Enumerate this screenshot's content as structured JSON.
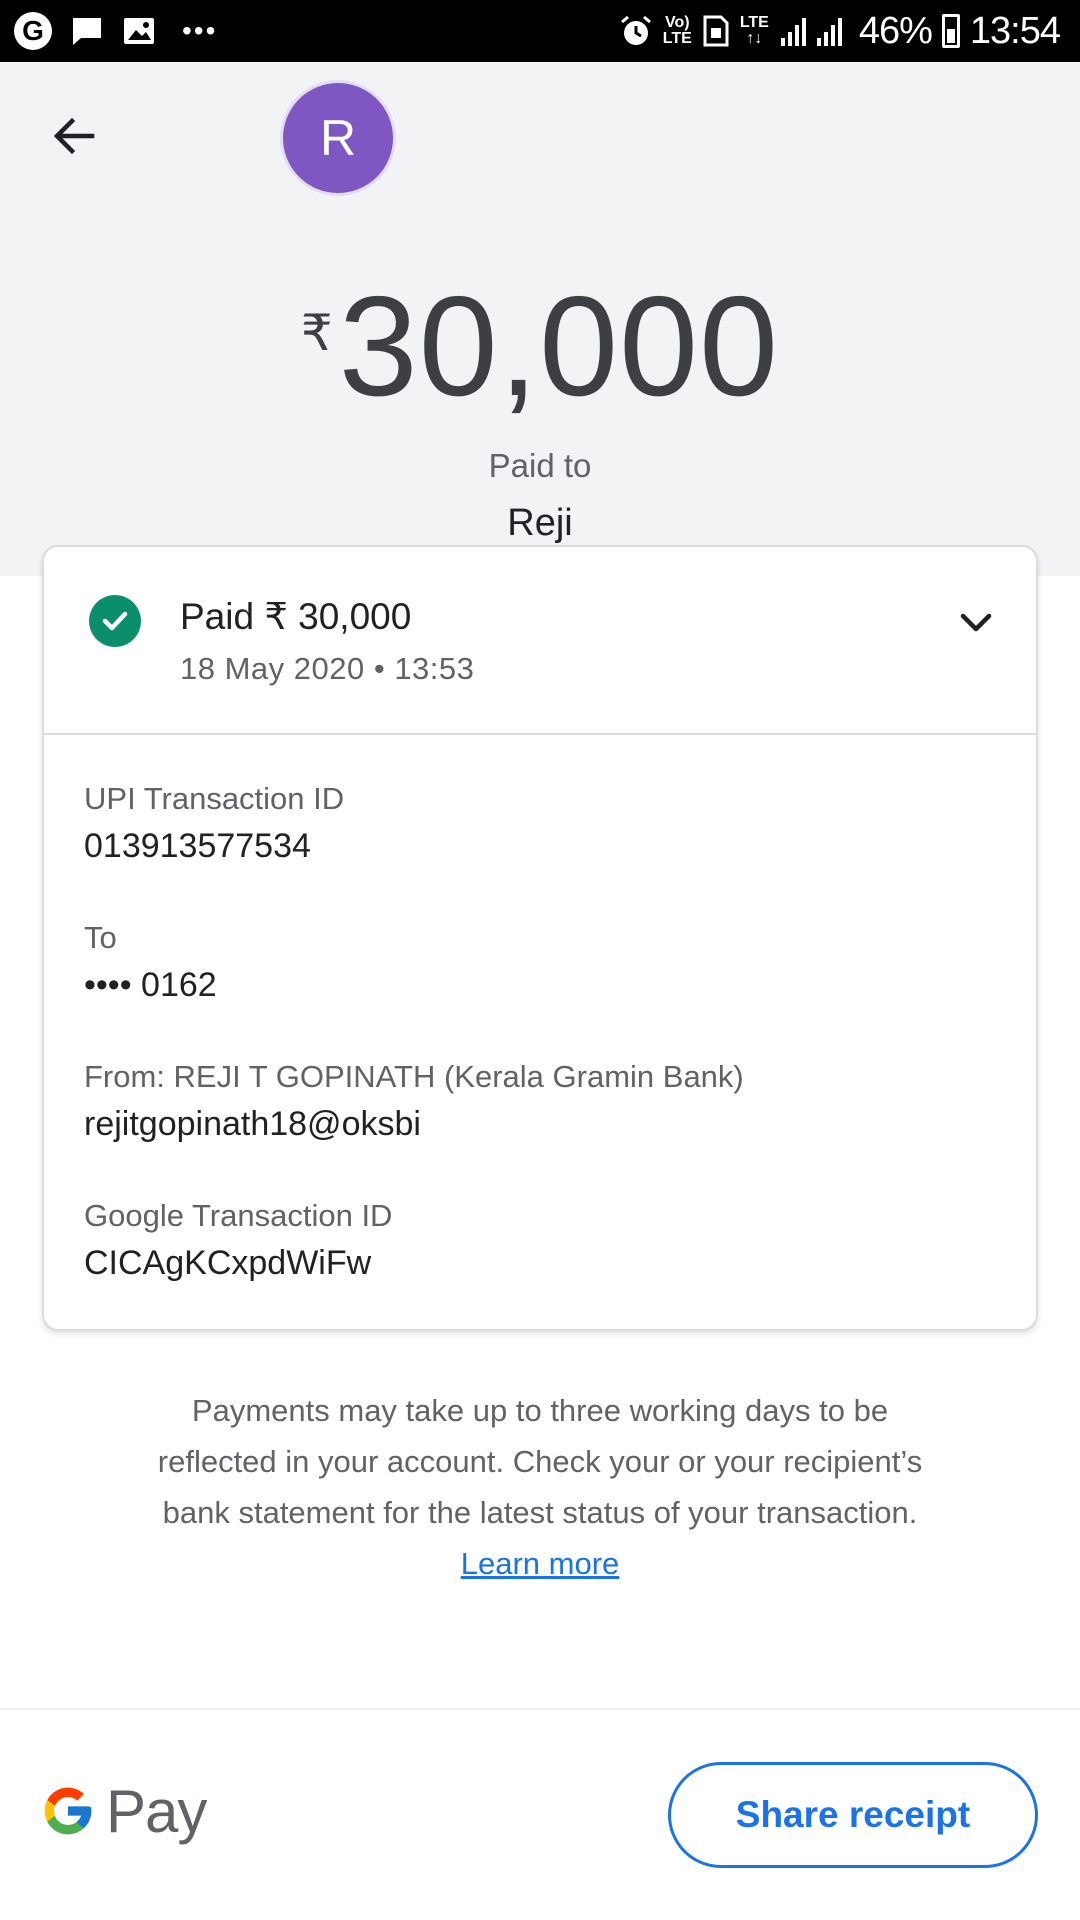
{
  "status_bar": {
    "lte_top": "Vo)",
    "lte_bottom": "LTE",
    "lte2": "LTE",
    "battery_percent": "46%",
    "time": "13:54",
    "icons": [
      "google-g-icon",
      "message-icon",
      "image-icon",
      "more-icon",
      "alarm-icon",
      "sim-icon",
      "signal-icon",
      "battery-icon"
    ]
  },
  "header": {
    "avatar_letter": "R",
    "avatar_color": "#7e57c2",
    "currency_symbol": "₹",
    "amount": "30,000",
    "paid_to_label": "Paid to",
    "payee_name": "Reji",
    "background": "#f1f3f4"
  },
  "transaction": {
    "status_title": "Paid ₹ 30,000",
    "date_time": "18 May 2020 • 13:53",
    "status_color": "#0b8f6b",
    "details": [
      {
        "label": "UPI Transaction ID",
        "value": "013913577534"
      },
      {
        "label": "To",
        "value": "•••• 0162"
      },
      {
        "label": "From: REJI T GOPINATH (Kerala Gramin Bank)",
        "value": "rejitgopinath18@oksbi"
      },
      {
        "label": "Google Transaction ID",
        "value": "CICAgKCxpdWiFw"
      }
    ]
  },
  "note": {
    "text": "Payments may take up to three working days to be reflected in your account. Check your or your recipient’s bank statement for the latest status of your transaction.",
    "link_text": "Learn more",
    "link_color": "#1a73e8"
  },
  "footer": {
    "brand_text": "Pay",
    "share_button_label": "Share receipt",
    "accent_color": "#1a73e8"
  }
}
